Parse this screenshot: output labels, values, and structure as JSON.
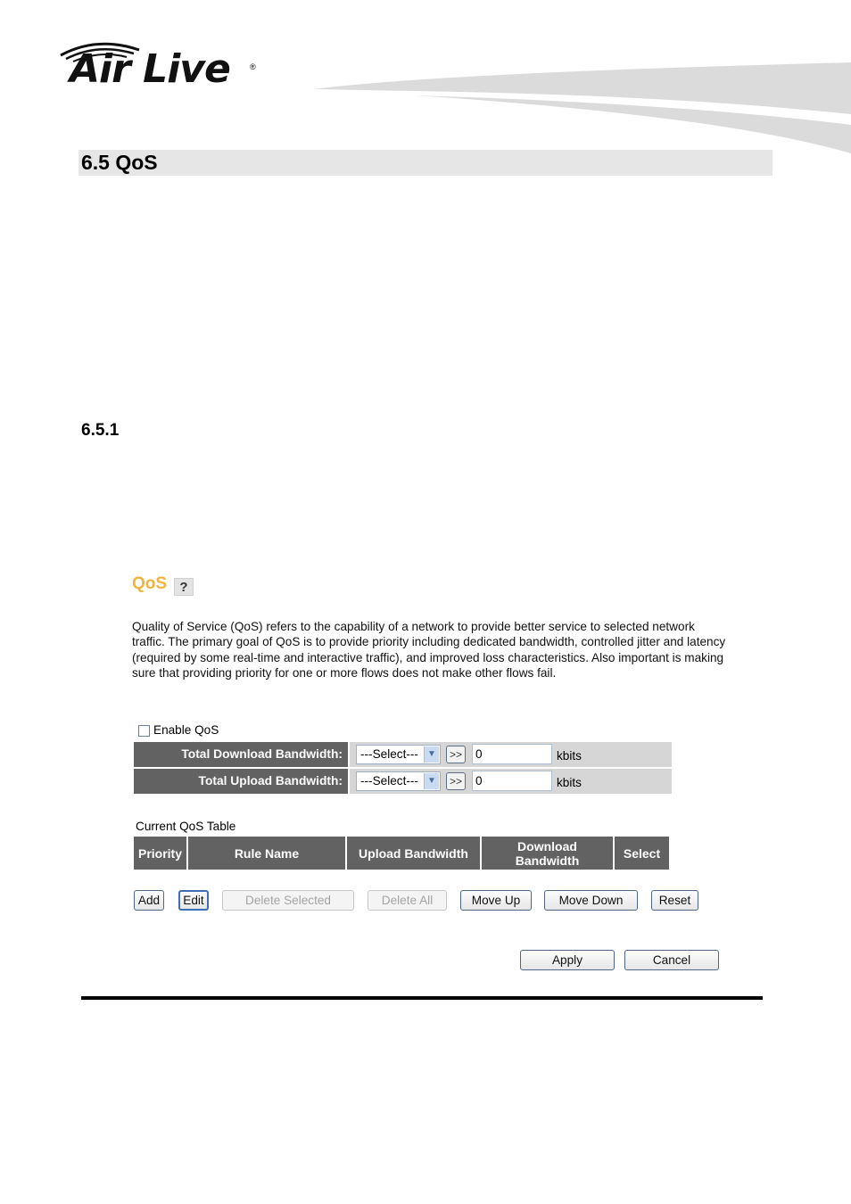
{
  "header": {
    "logo_text": "Air Live",
    "logo_registered": "®"
  },
  "document": {
    "section_title": "6.5 QoS",
    "subsection_title": "6.5.1"
  },
  "qos_panel": {
    "title": "QoS",
    "help_icon": "?",
    "description": "Quality of Service (QoS) refers to the capability of a network to provide better service to selected network traffic. The primary goal of QoS is to provide priority including dedicated bandwidth, controlled jitter and latency (required by some real-time and interactive traffic), and improved loss characteristics. Also important is making sure that providing priority for one or more flows does not make other flows fail.",
    "enable_qos": {
      "label": "Enable QoS",
      "checked": false
    },
    "bandwidth_rows": [
      {
        "label": "Total Download Bandwidth:",
        "select_value": "---Select---",
        "go_label": ">>",
        "value": "0",
        "unit": "kbits"
      },
      {
        "label": "Total Upload Bandwidth:",
        "select_value": "---Select---",
        "go_label": ">>",
        "value": "0",
        "unit": "kbits"
      }
    ],
    "table": {
      "caption": "Current QoS Table",
      "columns": [
        "Priority",
        "Rule Name",
        "Upload Bandwidth",
        "Download Bandwidth",
        "Select"
      ],
      "rows": []
    },
    "buttons": {
      "add": "Add",
      "edit": "Edit",
      "delete_selected": "Delete Selected",
      "delete_all": "Delete All",
      "move_up": "Move Up",
      "move_down": "Move Down",
      "reset": "Reset",
      "apply": "Apply",
      "cancel": "Cancel"
    }
  },
  "colors": {
    "qos_title": "#f2b33d",
    "header_cell": "#626262",
    "section_bar": "#e6e6e6"
  }
}
